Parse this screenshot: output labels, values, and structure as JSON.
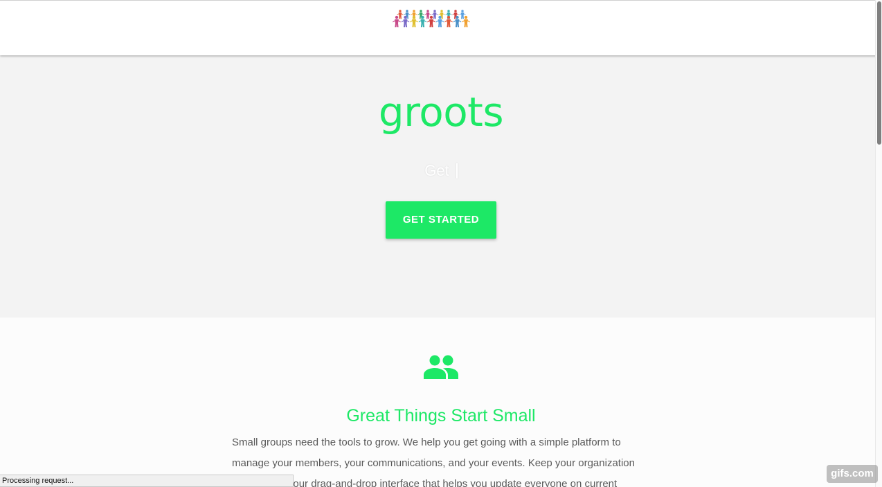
{
  "colors": {
    "accent": "#1de866",
    "hero_background": "#f3f3f3",
    "body_text": "#5a5a5a"
  },
  "navbar": {
    "logo_icon": "people-circle-logo"
  },
  "hero": {
    "title": "groots",
    "typed_text": "Get",
    "cta_label": "GET STARTED"
  },
  "features": {
    "icon": "group-icon",
    "title": "Great Things Start Small",
    "text": "Small groups need the tools to grow. We help you get going with a simple platform to manage your members, your communications, and your events. Keep your organization on track with our drag-and-drop interface that helps you update everyone on current"
  },
  "status_bar": {
    "text": "Processing request..."
  },
  "watermark": {
    "text": "gifs.com"
  }
}
